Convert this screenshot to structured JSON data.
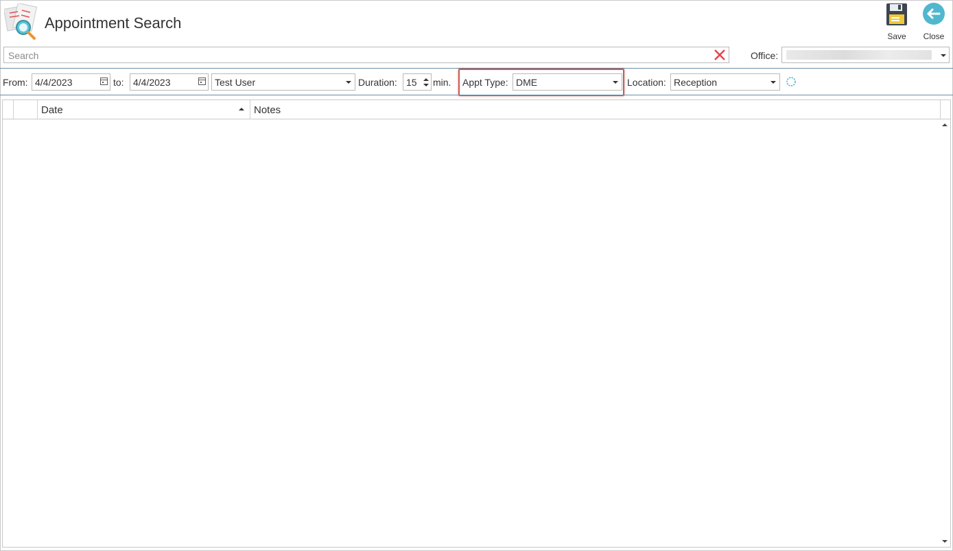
{
  "window": {
    "title": "Appointment Search"
  },
  "toolbar": {
    "save_label": "Save",
    "close_label": "Close"
  },
  "search": {
    "placeholder": "Search",
    "value": ""
  },
  "office": {
    "label": "Office:",
    "value": ""
  },
  "filters": {
    "from_label": "From:",
    "from_value": "4/4/2023",
    "to_label": "to:",
    "to_value": "4/4/2023",
    "user_value": "Test User",
    "duration_label": "Duration:",
    "duration_value": "15",
    "duration_unit": "min.",
    "appt_type_label": "Appt Type:",
    "appt_type_value": "DME",
    "location_label": "Location:",
    "location_value": "Reception"
  },
  "grid": {
    "columns": [
      "Date",
      "Notes"
    ],
    "sort_column": "Date",
    "sort_direction": "ascending",
    "rows": []
  },
  "colors": {
    "accent": "#4fb8cf",
    "highlight_border": "#d9534f",
    "clear_icon": "#e8434b",
    "divider": "#6a8ea8"
  }
}
